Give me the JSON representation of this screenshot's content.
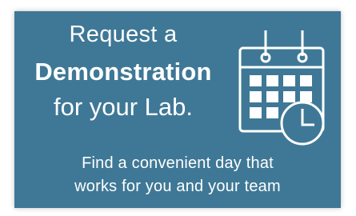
{
  "banner": {
    "background_color": "#3f7896",
    "text_color": "#ffffff",
    "headline": {
      "line1": "Request a",
      "line2": "Demonstration",
      "line3": "for your Lab."
    },
    "subtext": {
      "line1": "Find a convenient day that",
      "line2": "works for you and your team"
    },
    "icon": "calendar-clock-icon"
  }
}
